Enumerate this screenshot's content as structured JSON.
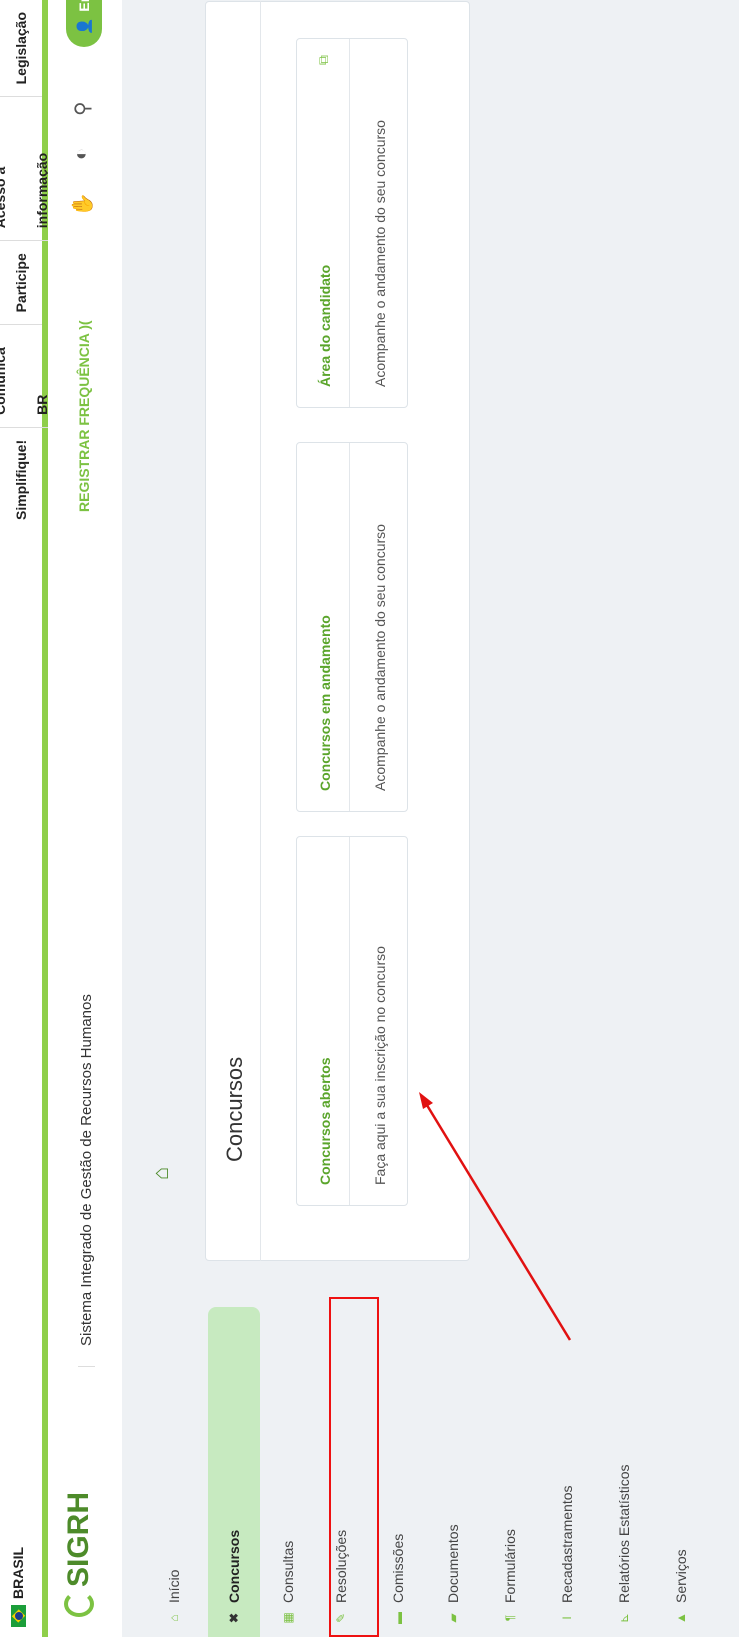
{
  "govbar": {
    "brand": "BRASIL",
    "links": [
      "Simplifique!",
      "Comunica BR",
      "Participe",
      "Acesso à informação",
      "Legislação"
    ]
  },
  "header": {
    "logo": "SIGRH",
    "system_name": "Sistema Integrado de Gestão de Recursos Humanos",
    "register": "REGISTRAR FREQUÊNCIA )(",
    "enter": "En",
    "icons": [
      "hand-icon",
      "contrast-icon",
      "search-icon"
    ]
  },
  "sidebar": {
    "items": [
      {
        "label": "Início",
        "icon": "home-icon"
      },
      {
        "label": "Concursos",
        "icon": "tools-icon"
      },
      {
        "label": "Consultas",
        "icon": "table-icon"
      },
      {
        "label": "Resoluções",
        "icon": "edit-icon"
      },
      {
        "label": "Comissões",
        "icon": "folder-icon"
      },
      {
        "label": "Documentos",
        "icon": "folder-open-icon"
      },
      {
        "label": "Formulários",
        "icon": "pilcrow-icon"
      },
      {
        "label": "Recadastramentos",
        "icon": "cursor-icon"
      },
      {
        "label": "Relatórios Estatísticos",
        "icon": "chart-icon"
      },
      {
        "label": "Serviços",
        "icon": "triangle-icon"
      }
    ]
  },
  "main": {
    "title": "Concursos",
    "cards": [
      {
        "title": "Concursos abertos",
        "desc": "Faça aqui a sua inscrição no concurso"
      },
      {
        "title": "Concursos em andamento",
        "desc": "Acompanhe o andamento do seu concurso"
      },
      {
        "title": "Área do candidato",
        "desc": "Acompanhe o andamento do seu concurso"
      }
    ]
  },
  "colors": {
    "accent": "#7cc242",
    "dark_green": "#4d8b2a",
    "highlight": "#e11111"
  }
}
